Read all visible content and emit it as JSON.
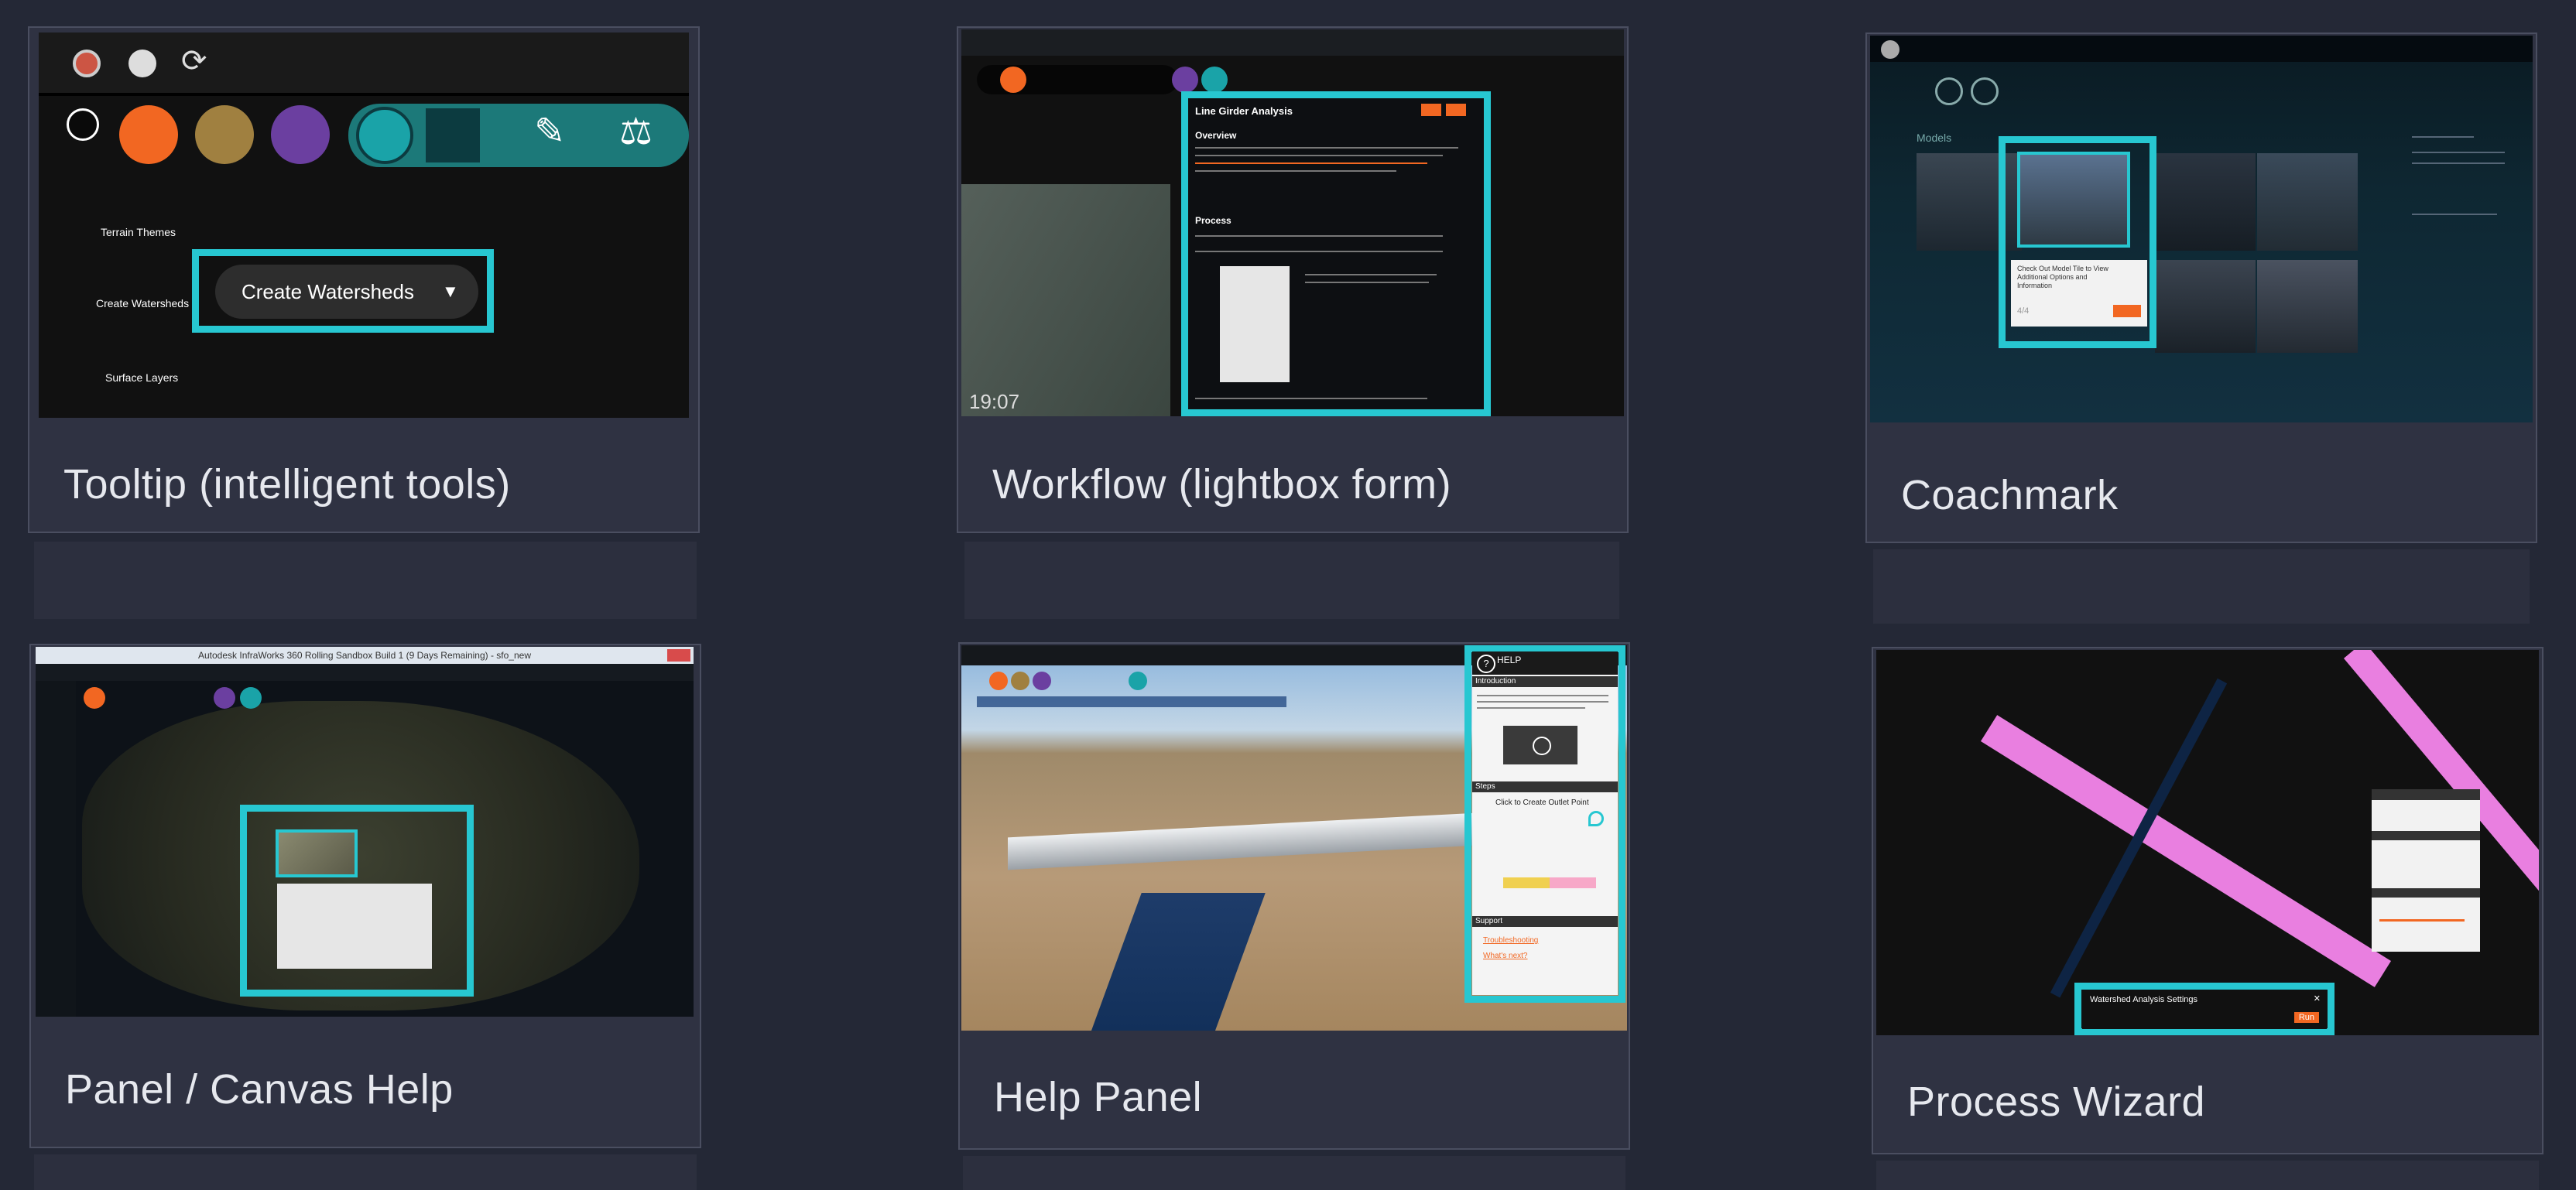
{
  "cards": [
    {
      "caption": "Tooltip (intelligent tools)",
      "tooltip": "Create Watersheds",
      "side_labels": [
        "Terrain Themes",
        "Create Watersheds",
        "Surface Layers"
      ]
    },
    {
      "caption": "Workflow (lightbox form)",
      "panel": {
        "title": "Line Girder Analysis",
        "overview_heading": "Overview",
        "process_heading": "Process",
        "time": "19:07"
      }
    },
    {
      "caption": "Coachmark",
      "section_label": "Models",
      "coach_text": "Check Out Model Tile to View Additional Options and Information",
      "step": "4/4"
    },
    {
      "caption": "Panel / Canvas Help",
      "window_title": "Autodesk InfraWorks 360 Rolling Sandbox Build 1 (9 Days Remaining) - sfo_new"
    },
    {
      "caption": "Help Panel",
      "help": {
        "title": "HELP",
        "intro_heading": "Introduction",
        "steps_heading": "Steps",
        "step_text": "Click to Create Outlet Point",
        "support_heading": "Support",
        "link_troubleshooting": "Troubleshooting",
        "link_whats_next": "What's next?"
      }
    },
    {
      "caption": "Process Wizard",
      "wizard_title": "Watershed Analysis Settings",
      "wizard_action": "Run"
    }
  ],
  "colors": {
    "background": "#242836",
    "card": "#2f3242",
    "highlight": "#27c7d1",
    "accent_orange": "#f26722",
    "accent_purple": "#6b3fa0",
    "accent_teal": "#1aa3a8"
  },
  "icons": [
    "user-icon",
    "chat-icon",
    "refresh-icon",
    "home-icon",
    "pen-icon",
    "scale-icon",
    "layers-icon",
    "play-icon",
    "help-icon"
  ]
}
